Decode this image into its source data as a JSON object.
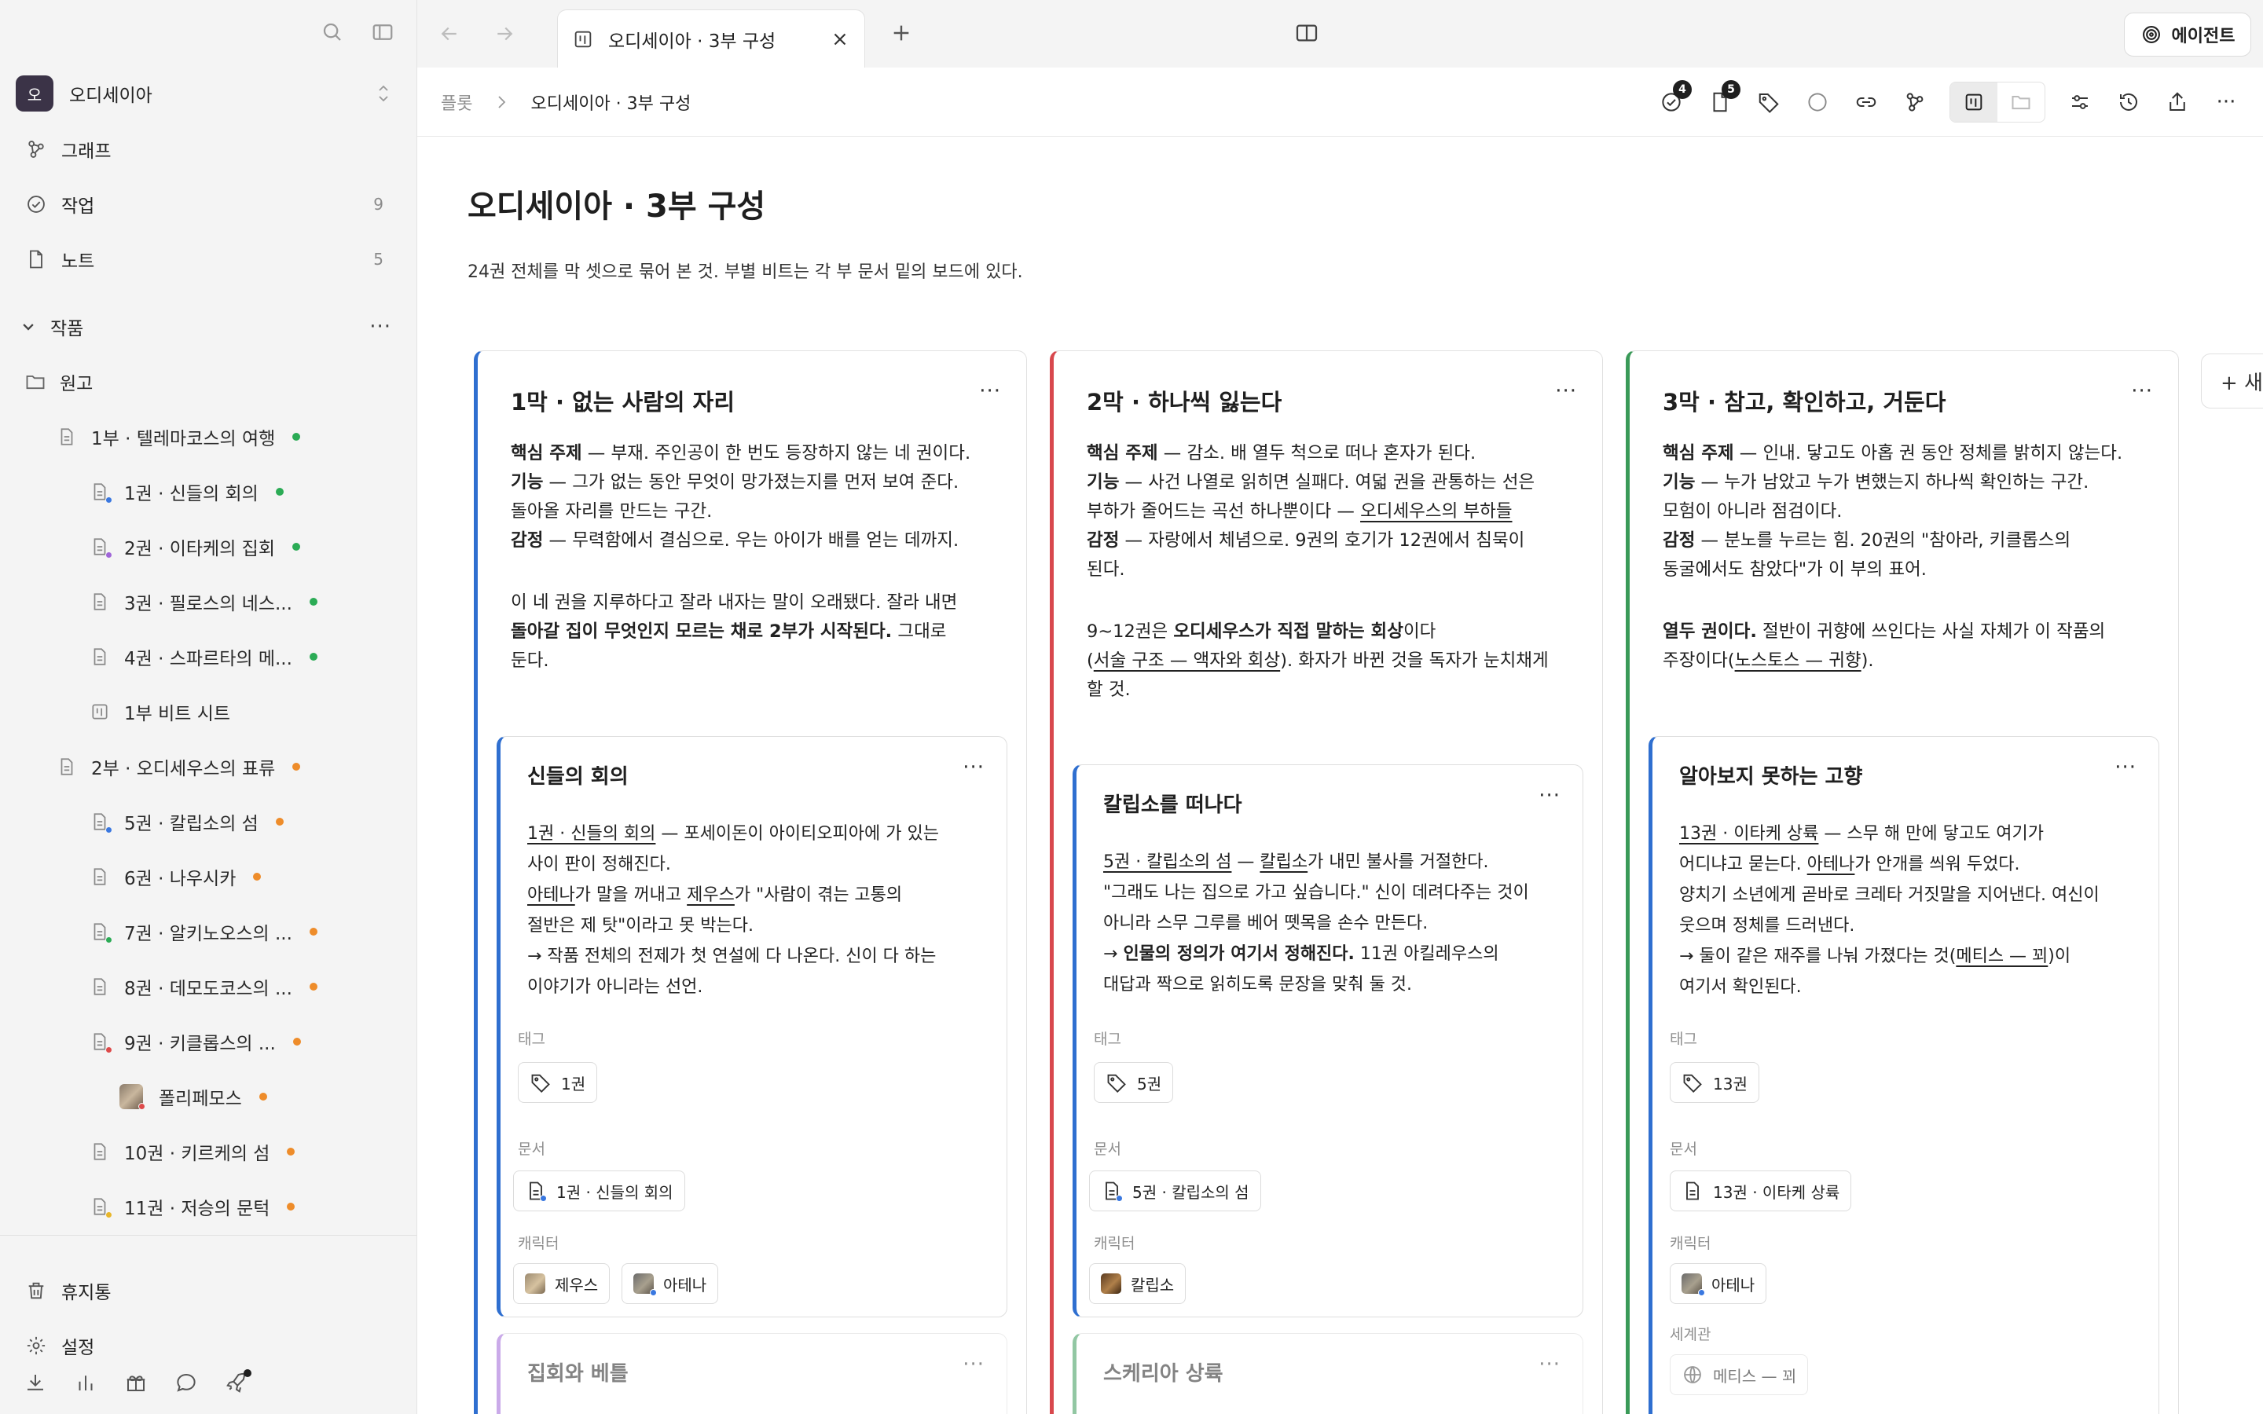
{
  "sidebar": {
    "workspace": {
      "badge": "오",
      "name": "오디세이아"
    },
    "nav": [
      {
        "label": "그래프",
        "count": "",
        "icon": "graph-icon"
      },
      {
        "label": "작업",
        "count": "9",
        "icon": "check-circle-icon"
      },
      {
        "label": "노트",
        "count": "5",
        "icon": "document-icon"
      }
    ],
    "section": {
      "label": "작품"
    },
    "tree": [
      {
        "label": "원고"
      },
      {
        "label": "1부 · 텔레마코스의 여행"
      },
      {
        "label": "1권 · 신들의 회의"
      },
      {
        "label": "2권 · 이타케의 집회"
      },
      {
        "label": "3권 · 필로스의 네스..."
      },
      {
        "label": "4권 · 스파르타의 메..."
      },
      {
        "label": "1부 비트 시트"
      },
      {
        "label": "2부 · 오디세우스의 표류"
      },
      {
        "label": "5권 · 칼립소의 섬"
      },
      {
        "label": "6권 · 나우시카"
      },
      {
        "label": "7권 · 알키노오스의 ..."
      },
      {
        "label": "8권 · 데모도코스의 ..."
      },
      {
        "label": "9권 · 키클롭스의 ..."
      },
      {
        "label": "폴리페모스"
      },
      {
        "label": "10권 · 키르케의 섬"
      },
      {
        "label": "11권 · 저승의 문턱"
      }
    ],
    "bottom": {
      "trash": "휴지통",
      "settings": "설정"
    }
  },
  "tabbar": {
    "tab_title": "오디세이아 · 3부 구성",
    "agent_label": "에이전트"
  },
  "toolbar": {
    "crumb_root": "플롯",
    "crumb_current": "오디세이아 · 3부 구성",
    "tasks_badge": "4",
    "notes_badge": "5"
  },
  "page": {
    "title": "오디세이아 · 3부 구성",
    "desc": "24권 전체를 막 셋으로 묶어 본 것. 부별 비트는 각 부 문서 밑의 보드에 있다."
  },
  "columns": [
    {
      "title": "1막 · 없는 사람의 자리",
      "lines": {
        "theme_k": "핵심 주제",
        "theme_v": " — 부재. 주인공이 한 번도 등장하지 않는 네 권이다.",
        "func_k": "기능",
        "func_v": " — 그가 없는 동안 무엇이 망가졌는지를 먼저 보여 준다.",
        "func_v2": "돌아올 자리를 만드는 구간.",
        "emo_k": "감정",
        "emo_v": " — 무력함에서 결심으로. 우는 아이가 배를 얻는 데까지.",
        "p2a": "이 네 권을 지루하다고 잘라 내자는 말이 오래됐다. 잘라 내면",
        "p2b": "돌아갈 집이 무엇인지 모르는 채로 2부가 시작된다.",
        "p2c": " 그대로",
        "p2d": "둔다."
      },
      "card": {
        "title": "신들의 회의",
        "l1a": "1권 · 신들의 회의",
        "l1b": " — 포세이돈이 아이티오피아에 가 있는",
        "l2": "사이 판이 정해진다.",
        "l3a": "아테나",
        "l3b": "가 말을 꺼내고 ",
        "l3c": "제우스",
        "l3d": "가 \"사람이 겪는 고통의",
        "l4": "절반은 제 탓\"이라고 못 박는다.",
        "l5": "→ 작품 전체의 전제가 첫 연설에 다 나온다. 신이 다 하는",
        "l6": "이야기가 아니라는 선언.",
        "tag_label": "태그",
        "tag": "1권",
        "doc_label": "문서",
        "doc": "1권 · 신들의 회의",
        "char_label": "캐릭터",
        "char1": "제우스",
        "char2": "아테나"
      },
      "next_card": "집회와 베틀"
    },
    {
      "title": "2막 · 하나씩 잃는다",
      "lines": {
        "theme_k": "핵심 주제",
        "theme_v": " — 감소. 배 열두 척으로 떠나 혼자가 된다.",
        "func_k": "기능",
        "func_v": " — 사건 나열로 읽히면 실패다. 여덟 권을 관통하는 선은",
        "func_v2a": "부하가 줄어드는 곡선 하나뿐이다 — ",
        "func_v2b": "오디세우스의 부하들",
        "emo_k": "감정",
        "emo_v": " — 자랑에서 체념으로. 9권의 호기가 12권에서 침묵이",
        "emo_v2": "된다.",
        "p2a": "9~12권은 ",
        "p2b": "오디세우스가 직접 말하는 회상",
        "p2c": "이다",
        "p2d": "(",
        "p2e": "서술 구조 — 액자와 회상",
        "p2f": "). 화자가 바뀐 것을 독자가 눈치채게",
        "p2g": "할 것."
      },
      "card": {
        "title": "칼립소를 떠나다",
        "l1a": "5권 · 칼립소의 섬",
        "l1b": " — ",
        "l1c": "칼립소",
        "l1d": "가 내민 불사를 거절한다.",
        "l2": "\"그래도 나는 집으로 가고 싶습니다.\" 신이 데려다주는 것이",
        "l3": "아니라 스무 그루를 베어 뗏목을 손수 만든다.",
        "l4a": "→ ",
        "l4b": "인물의 정의가 여기서 정해진다.",
        "l4c": " 11권 아킬레우스의",
        "l5": "대답과 짝으로 읽히도록 문장을 맞춰 둘 것.",
        "tag_label": "태그",
        "tag": "5권",
        "doc_label": "문서",
        "doc": "5권 · 칼립소의 섬",
        "char_label": "캐릭터",
        "char1": "칼립소"
      },
      "next_card": "스케리아 상륙"
    },
    {
      "title": "3막 · 참고, 확인하고, 거둔다",
      "lines": {
        "theme_k": "핵심 주제",
        "theme_v": " — 인내. 닿고도 아홉 권 동안 정체를 밝히지 않는다.",
        "func_k": "기능",
        "func_v": " — 누가 남았고 누가 변했는지 하나씩 확인하는 구간.",
        "func_v2": "모험이 아니라 점검이다.",
        "emo_k": "감정",
        "emo_v": " — 분노를 누르는 힘. 20권의 \"참아라, 키클롭스의",
        "emo_v2": "동굴에서도 참았다\"가 이 부의 표어.",
        "p2a": "열두 권이다.",
        "p2b": " 절반이 귀향에 쓰인다는 사실 자체가 이 작품의",
        "p2c": "주장이다(",
        "p2d": "노스토스 — 귀향",
        "p2e": ")."
      },
      "card": {
        "title": "알아보지 못하는 고향",
        "l1a": "13권 · 이타케 상륙",
        "l1b": " — 스무 해 만에 닿고도 여기가",
        "l2a": "어디냐고 묻는다. ",
        "l2b": "아테나",
        "l2c": "가 안개를 씌워 두었다.",
        "l3": "양치기 소년에게 곧바로 크레타 거짓말을 지어낸다. 여신이",
        "l4": "웃으며 정체를 드러낸다.",
        "l5a": "→ 둘이 같은 재주를 나눠 가졌다는 것(",
        "l5b": "메티스 — 꾀",
        "l5c": ")이",
        "l6": "여기서 확인된다.",
        "tag_label": "태그",
        "tag": "13권",
        "doc_label": "문서",
        "doc": "13권 · 이타케 상륙",
        "char_label": "캐릭터",
        "char1": "아테나",
        "world_label": "세계관",
        "world": "메티스 — 꾀"
      }
    }
  ],
  "add_column_label": "+ 새",
  "colors": {
    "act1": "#2f6fd0",
    "act2": "#d8484d",
    "act3": "#3a9a58",
    "orange": "#ee8c2a",
    "green": "#2bab55",
    "blue": "#3a78e0",
    "purple": "#a066d8",
    "red": "#de4a4a",
    "yellow": "#e8b62a"
  }
}
